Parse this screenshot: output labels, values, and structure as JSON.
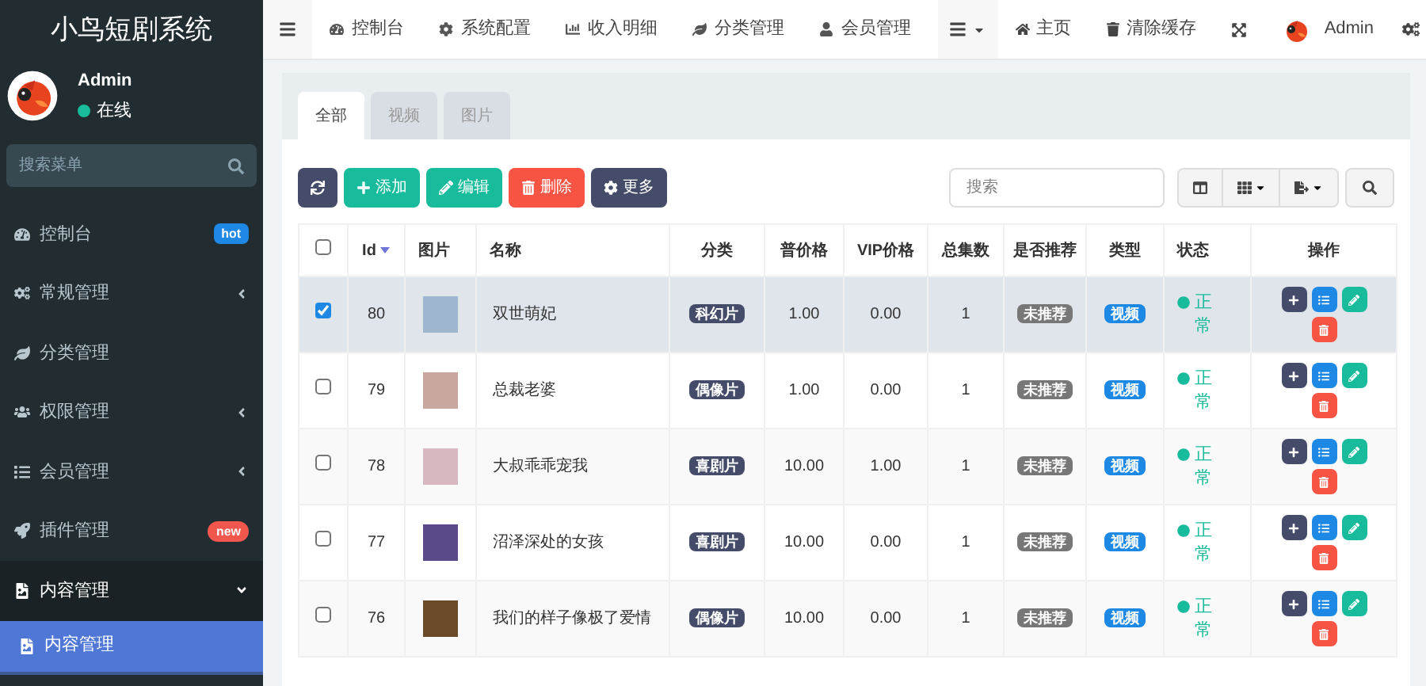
{
  "sidebar": {
    "title": "小鸟短剧系统",
    "user": {
      "name": "Admin",
      "status": "在线",
      "online": true
    },
    "search": {
      "placeholder": "搜索菜单"
    },
    "menu": [
      {
        "label": "控制台",
        "badge": "hot",
        "color": "#1e88e5",
        "expandable": false,
        "expanded": false
      },
      {
        "label": "常规管理",
        "expandable": true,
        "expanded": false
      },
      {
        "label": "分类管理",
        "expandable": false,
        "expanded": false
      },
      {
        "label": "权限管理",
        "expandable": true,
        "expanded": false
      },
      {
        "label": "会员管理",
        "expandable": true,
        "expanded": false
      },
      {
        "label": "插件管理",
        "badge": "new",
        "color": "#f2574d",
        "expandable": false,
        "expanded": false
      },
      {
        "label": "内容管理",
        "expandable": true,
        "expanded": true,
        "children": [
          {
            "label": "内容管理",
            "selected": true
          }
        ]
      }
    ]
  },
  "topbar": {
    "nav": [
      "控制台",
      "系统配置",
      "收入明细",
      "分类管理",
      "会员管理"
    ],
    "right": [
      "主页",
      "清除缓存"
    ],
    "user": "Admin"
  },
  "tabs": [
    {
      "label": "全部",
      "selected": true
    },
    {
      "label": "视频",
      "selected": false
    },
    {
      "label": "图片",
      "selected": false
    }
  ],
  "toolbar": {
    "buttons": [
      {
        "kind": "refresh"
      },
      {
        "kind": "add",
        "label": "添加"
      },
      {
        "kind": "edit",
        "label": "编辑"
      },
      {
        "kind": "delete",
        "label": "删除"
      },
      {
        "kind": "more",
        "label": "更多"
      }
    ],
    "search": {
      "placeholder": "搜索"
    }
  },
  "table": {
    "columns": [
      "Id",
      "图片",
      "名称",
      "分类",
      "普价格",
      "VIP价格",
      "总集数",
      "是否推荐",
      "类型",
      "状态",
      "操作"
    ],
    "rows": [
      {
        "checked": true,
        "id": "80",
        "name": "双世萌妃",
        "category": "科幻片",
        "price": "1.00",
        "vip_price": "0.00",
        "episodes": "1",
        "recommend": "未推荐",
        "type": "视频",
        "status": "正常"
      },
      {
        "checked": false,
        "id": "79",
        "name": "总裁老婆",
        "category": "偶像片",
        "price": "1.00",
        "vip_price": "0.00",
        "episodes": "1",
        "recommend": "未推荐",
        "type": "视频",
        "status": "正常"
      },
      {
        "checked": false,
        "id": "78",
        "name": "大叔乖乖宠我",
        "category": "喜剧片",
        "price": "10.00",
        "vip_price": "1.00",
        "episodes": "1",
        "recommend": "未推荐",
        "type": "视频",
        "status": "正常"
      },
      {
        "checked": false,
        "id": "77",
        "name": "沼泽深处的女孩",
        "category": "喜剧片",
        "price": "10.00",
        "vip_price": "0.00",
        "episodes": "1",
        "recommend": "未推荐",
        "type": "视频",
        "status": "正常"
      },
      {
        "checked": false,
        "id": "76",
        "name": "我们的样子像极了爱情",
        "category": "偶像片",
        "price": "10.00",
        "vip_price": "0.00",
        "episodes": "1",
        "recommend": "未推荐",
        "type": "视频",
        "status": "正常"
      }
    ],
    "all_checked": false
  }
}
